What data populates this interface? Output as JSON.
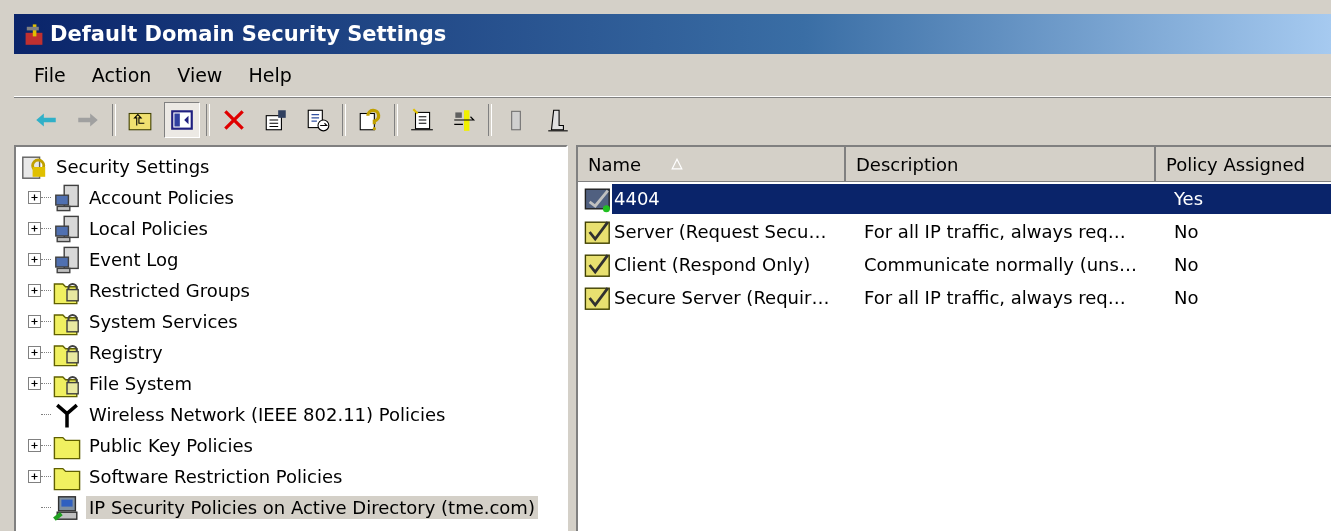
{
  "window": {
    "title": "Default Domain Security Settings"
  },
  "menu": [
    "File",
    "Action",
    "View",
    "Help"
  ],
  "toolbar": [
    {
      "kind": "back",
      "pressed": false
    },
    {
      "kind": "forward",
      "pressed": false
    },
    {
      "kind": "sep"
    },
    {
      "kind": "up",
      "pressed": false
    },
    {
      "kind": "tree",
      "pressed": true
    },
    {
      "kind": "sep"
    },
    {
      "kind": "delete",
      "pressed": false
    },
    {
      "kind": "properties",
      "pressed": false
    },
    {
      "kind": "export",
      "pressed": false
    },
    {
      "kind": "sep"
    },
    {
      "kind": "help",
      "pressed": false
    },
    {
      "kind": "sep"
    },
    {
      "kind": "new",
      "pressed": false
    },
    {
      "kind": "assign",
      "pressed": false
    },
    {
      "kind": "sep"
    },
    {
      "kind": "unassign",
      "pressed": false
    },
    {
      "kind": "stand",
      "pressed": false
    }
  ],
  "tree": {
    "label": "Security Settings",
    "kind": "shield",
    "selected": false,
    "children": [
      {
        "label": "Account Policies",
        "kind": "computers",
        "expandable": true,
        "selected": false
      },
      {
        "label": "Local Policies",
        "kind": "computers",
        "expandable": true,
        "selected": false
      },
      {
        "label": "Event Log",
        "kind": "computers",
        "expandable": true,
        "selected": false
      },
      {
        "label": "Restricted Groups",
        "kind": "lockfolder",
        "expandable": true,
        "selected": false
      },
      {
        "label": "System Services",
        "kind": "lockfolder",
        "expandable": true,
        "selected": false
      },
      {
        "label": "Registry",
        "kind": "lockfolder",
        "expandable": true,
        "selected": false
      },
      {
        "label": "File System",
        "kind": "lockfolder",
        "expandable": true,
        "selected": false
      },
      {
        "label": "Wireless Network (IEEE 802.11) Policies",
        "kind": "antenna",
        "expandable": false,
        "selected": false
      },
      {
        "label": "Public Key Policies",
        "kind": "folder",
        "expandable": true,
        "selected": false
      },
      {
        "label": "Software Restriction Policies",
        "kind": "folder",
        "expandable": true,
        "selected": false
      },
      {
        "label": "IP Security Policies on Active Directory (tme.com)",
        "kind": "network",
        "expandable": false,
        "selected": true
      }
    ]
  },
  "table": {
    "columns": [
      {
        "label": "Name",
        "sorted": true
      },
      {
        "label": "Description",
        "sorted": false
      },
      {
        "label": "Policy Assigned",
        "sorted": false
      }
    ],
    "rows": [
      {
        "name": "4404",
        "assigned": "Yes",
        "kind": "assigned",
        "selected": true
      },
      {
        "name": "Server (Request Secu…",
        "description": "For all IP traffic, always req…",
        "assigned": "No",
        "kind": "policy",
        "selected": false
      },
      {
        "name": "Client (Respond Only)",
        "description": "Communicate normally (uns…",
        "assigned": "No",
        "kind": "policy",
        "selected": false
      },
      {
        "name": "Secure Server (Requir…",
        "description": "For all IP traffic, always req…",
        "assigned": "No",
        "kind": "policy",
        "selected": false
      }
    ]
  }
}
